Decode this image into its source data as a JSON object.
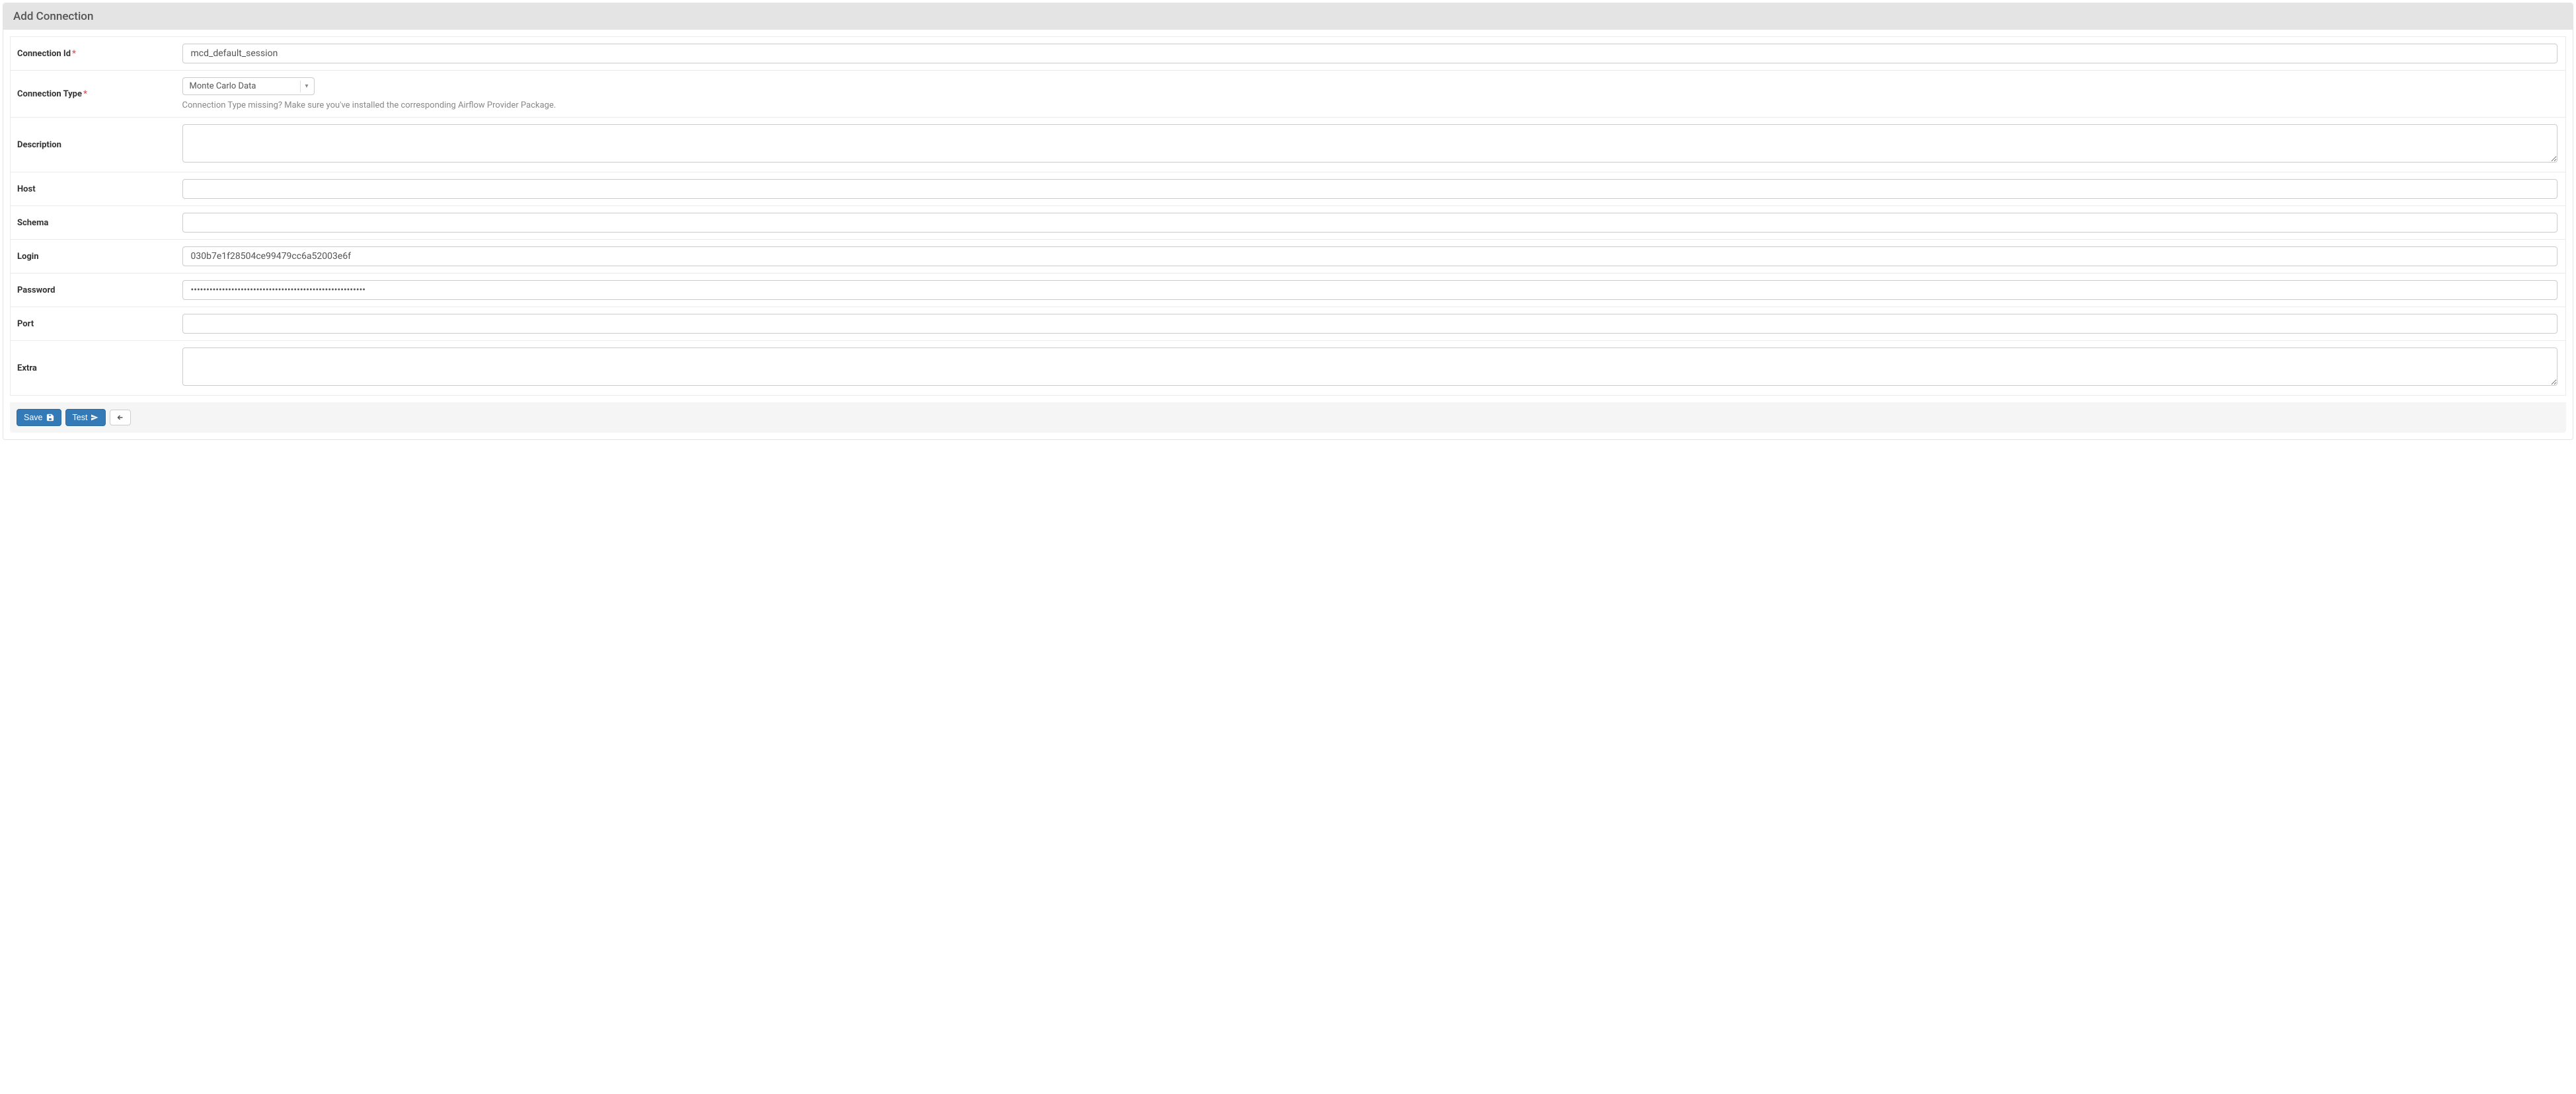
{
  "panel": {
    "title": "Add Connection"
  },
  "fields": {
    "connection_id": {
      "label": "Connection Id",
      "required": true,
      "value": "mcd_default_session"
    },
    "connection_type": {
      "label": "Connection Type",
      "required": true,
      "selected": "Monte Carlo Data",
      "help": "Connection Type missing? Make sure you've installed the corresponding Airflow Provider Package."
    },
    "description": {
      "label": "Description",
      "value": ""
    },
    "host": {
      "label": "Host",
      "value": ""
    },
    "schema": {
      "label": "Schema",
      "value": ""
    },
    "login": {
      "label": "Login",
      "value": "030b7e1f28504ce99479cc6a52003e6f"
    },
    "password": {
      "label": "Password",
      "value": "••••••••••••••••••••••••••••••••••••••••••••••••••••••••"
    },
    "port": {
      "label": "Port",
      "value": ""
    },
    "extra": {
      "label": "Extra",
      "value": ""
    }
  },
  "footer": {
    "save_label": "Save",
    "test_label": "Test"
  }
}
